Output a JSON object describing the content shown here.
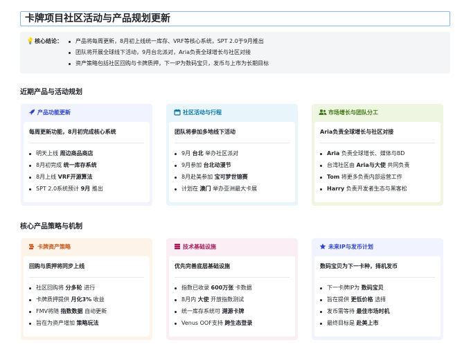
{
  "title": "卡牌项目社区活动与产品规划更新",
  "summary": {
    "label": "核心结论：",
    "items": [
      "产品将每周更新，8月初上线统一库存、VRF等核心系统，SPT 2.0于9月推出",
      "团队将开展全球线下活动，9月台北派对，Aria负责全球增长与社区对接",
      "资产策略包括社区回购与卡牌质押，下一IP为数码宝贝，发币与上市为长期目标"
    ]
  },
  "sections": [
    {
      "title": "近期产品与活动规划",
      "cards": [
        {
          "icon": "rocket-icon",
          "title": "产品功能更新",
          "headline": "每周更新功能，8月初完成核心系统",
          "items": [
            [
              {
                "t": "明天上线 "
              },
              {
                "t": "周边商品商店",
                "b": true
              }
            ],
            [
              {
                "t": "8月初完成 "
              },
              {
                "t": "统一库存系统",
                "b": true
              }
            ],
            [
              {
                "t": "8月上线 "
              },
              {
                "t": "VRF开源算法",
                "b": true
              }
            ],
            [
              {
                "t": "SPT 2.0系统预计 "
              },
              {
                "t": "9月",
                "b": true
              },
              {
                "t": " 推出"
              }
            ]
          ]
        },
        {
          "icon": "calendar-icon",
          "title": "社区活动与行程",
          "headline": "团队将参加多地线下活动",
          "items": [
            [
              {
                "t": "9月 "
              },
              {
                "t": "台北",
                "b": true
              },
              {
                "t": " 举办社区派对"
              }
            ],
            [
              {
                "t": "9月参加 "
              },
              {
                "t": "台北动漫节",
                "b": true
              }
            ],
            [
              {
                "t": "8月赴美参加 "
              },
              {
                "t": "宝可梦世锦赛",
                "b": true
              }
            ],
            [
              {
                "t": "计划在 "
              },
              {
                "t": "澳门",
                "b": true
              },
              {
                "t": " 举办亚洲最大卡展"
              }
            ]
          ]
        },
        {
          "icon": "users-icon",
          "title": "市场增长与团队分工",
          "headline": "Aria负责全球增长与社区对接",
          "items": [
            [
              {
                "t": "Aria",
                "b": true
              },
              {
                "t": " 负责全球增长、媒体与BD"
              }
            ],
            [
              {
                "t": "台湾社区由 "
              },
              {
                "t": "Aria与大使",
                "b": true
              },
              {
                "t": " 共同负责"
              }
            ],
            [
              {
                "t": "Tom",
                "b": true
              },
              {
                "t": " 将更多负责内部运营工作"
              }
            ],
            [
              {
                "t": "Harry",
                "b": true
              },
              {
                "t": " 负责开发者生态与黑客松"
              }
            ]
          ]
        }
      ]
    },
    {
      "title": "核心产品策略与机制",
      "cards": [
        {
          "icon": "coins-icon",
          "title": "卡牌资产策略",
          "headline": "回购与质押将同步上线",
          "items": [
            [
              {
                "t": "社区回购将 "
              },
              {
                "t": "分多轮",
                "b": true
              },
              {
                "t": " 进行"
              }
            ],
            [
              {
                "t": "卡牌质押提供 "
              },
              {
                "t": "月化3%",
                "b": true
              },
              {
                "t": " 收益"
              }
            ],
            [
              {
                "t": "FMV将随 "
              },
              {
                "t": "指数数据",
                "b": true
              },
              {
                "t": " 自动更新"
              }
            ],
            [
              {
                "t": "旨在为资产增加 "
              },
              {
                "t": "策略玩法",
                "b": true
              }
            ]
          ]
        },
        {
          "icon": "database-icon",
          "title": "技术基础设施",
          "headline": "优先完善底层基础设施",
          "items": [
            [
              {
                "t": "指数已收录 "
              },
              {
                "t": "600万张",
                "b": true
              },
              {
                "t": " 卡数据"
              }
            ],
            [
              {
                "t": "8月内 "
              },
              {
                "t": "大使",
                "b": true
              },
              {
                "t": " 开放指数测试"
              }
            ],
            [
              {
                "t": "统一库存系统可 "
              },
              {
                "t": "溯源卡牌",
                "b": true
              }
            ],
            [
              {
                "t": "Venus OOF支持 "
              },
              {
                "t": "跨生态登录",
                "b": true
              }
            ]
          ]
        },
        {
          "icon": "star-icon",
          "title": "未来IP与发币计划",
          "headline": "数码宝贝为下一卡种，择机发币",
          "items": [
            [
              {
                "t": "下一卡牌IP为 "
              },
              {
                "t": "数码宝贝",
                "b": true
              }
            ],
            [
              {
                "t": "旨在提供 "
              },
              {
                "t": "更低价格",
                "b": true
              },
              {
                "t": " 选择"
              }
            ],
            [
              {
                "t": "发币需等待 "
              },
              {
                "t": "最佳市场时机",
                "b": true
              }
            ],
            [
              {
                "t": "最终目标是 "
              },
              {
                "t": "赴美上市",
                "b": true
              }
            ]
          ]
        }
      ]
    }
  ],
  "colors": {
    "blue": "#2e43c9",
    "cyan": "#0a77a8",
    "green": "#3d7a12",
    "orange": "#c8561b",
    "pink": "#a61e5c",
    "bulb": "#f5b400"
  }
}
